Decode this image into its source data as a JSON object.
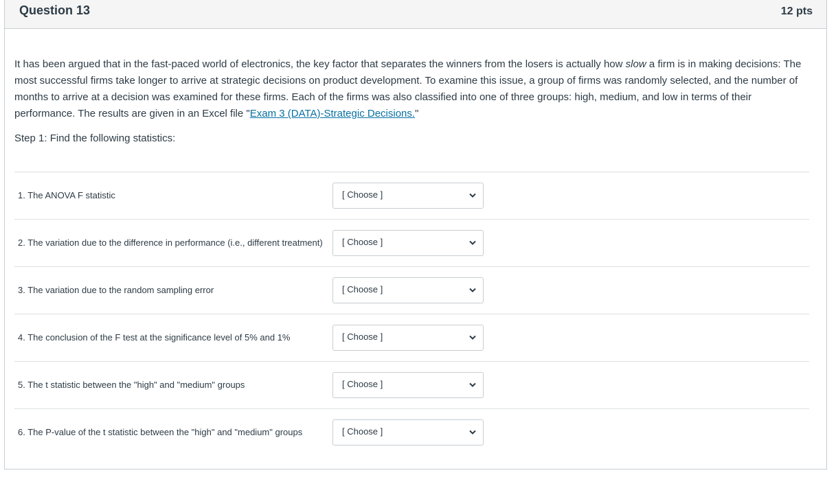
{
  "header": {
    "title": "Question 13",
    "points": "12 pts"
  },
  "body": {
    "para_before_slow": "It has been argued that in the fast-paced world of electronics, the key factor that separates the winners from the losers is actually how ",
    "slow_word": "slow",
    "para_after_slow": " a firm is in making decisions: The most successful firms take longer to arrive at strategic decisions on product development. To examine this issue, a group of firms was randomly selected, and the number of months to arrive at a decision was examined for these firms. Each of the firms was also classified into one of three groups: high, medium, and low in terms of their performance. The results are given in an Excel file \"",
    "link_text": "Exam 3 (DATA)-Strategic Decisions.",
    "para_end": "\"",
    "step": "Step 1: Find the following statistics:"
  },
  "items": [
    {
      "label": "1. The ANOVA F statistic",
      "select": "[ Choose ]"
    },
    {
      "label": "2. The variation due to the difference in performance (i.e., different treatment)",
      "select": "[ Choose ]"
    },
    {
      "label": "3. The variation due to the random sampling error",
      "select": "[ Choose ]"
    },
    {
      "label": "4. The conclusion of the F test at the significance level of 5% and 1%",
      "select": "[ Choose ]"
    },
    {
      "label": "5. The t statistic between the \"high\" and \"medium\" groups",
      "select": "[ Choose ]"
    },
    {
      "label": "6. The P-value of the t statistic between the \"high\" and \"medium\" groups",
      "select": "[ Choose ]"
    }
  ],
  "colors": {
    "link": "#0770a3",
    "text": "#2d3b45",
    "header_bg": "#f5f5f5",
    "border": "#c7cdd1"
  },
  "icons": {
    "dropdown": "chevron-down-icon"
  }
}
